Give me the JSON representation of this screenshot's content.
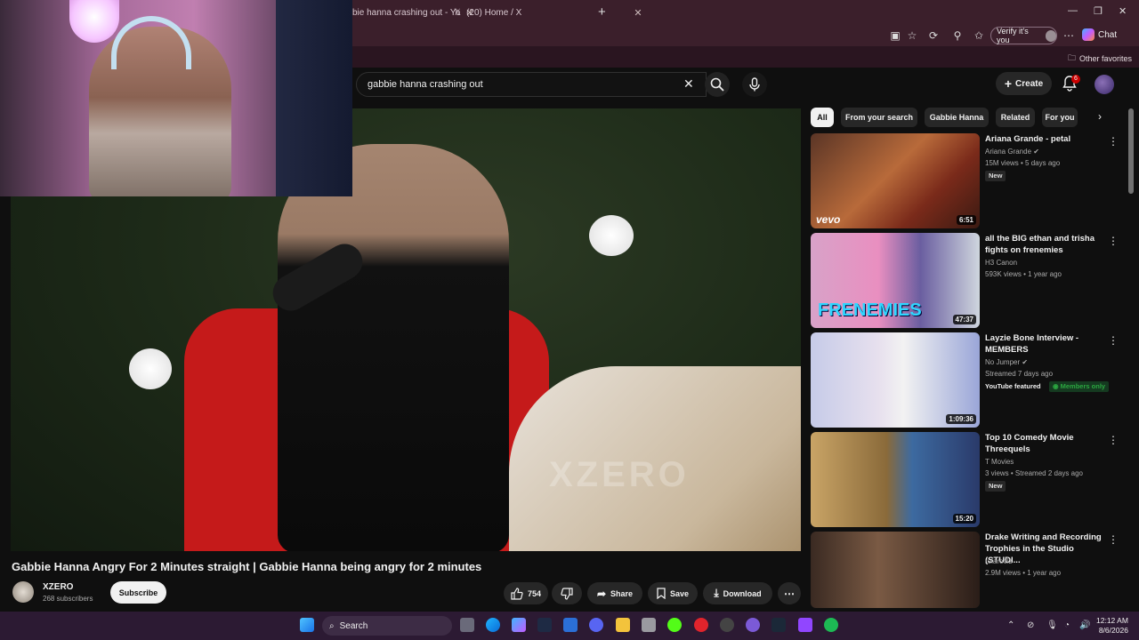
{
  "browser": {
    "tabs": [
      {
        "label": "bie hanna crashing out - Yo"
      },
      {
        "label": "(20) Home / X"
      }
    ],
    "verify_label": "Verify it's you",
    "chat_label": "Chat",
    "other_favorites": "Other favorites"
  },
  "youtube": {
    "search_value": "gabbie hanna crashing out",
    "create_label": "Create",
    "notification_count": "6"
  },
  "video": {
    "watermark": "XZERO",
    "title": "Gabbie Hanna Angry For 2 Minutes straight | Gabbie Hanna being angry for 2 minutes",
    "channel": "XZERO",
    "subscribers": "268 subscribers",
    "subscribe_label": "Subscribe",
    "likes": "754",
    "share_label": "Share",
    "save_label": "Save",
    "download_label": "Download"
  },
  "chips": [
    {
      "label": "All"
    },
    {
      "label": "From your search"
    },
    {
      "label": "Gabbie Hanna"
    },
    {
      "label": "Related"
    },
    {
      "label": "For you"
    }
  ],
  "recommendations": [
    {
      "title": "Ariana Grande - petal",
      "channel": "Ariana Grande",
      "meta": "15M views • 5 days ago",
      "badge": "New",
      "duration": "6:51",
      "overlay": "vevo"
    },
    {
      "title": "all the BIG ethan and trisha fights on frenemies",
      "channel": "H3 Canon",
      "meta": "593K views • 1 year ago",
      "badge": "",
      "duration": "47:37",
      "overlay": "FRENEMIES"
    },
    {
      "title": "Layzie Bone Interview - MEMBERS",
      "channel": "No Jumper",
      "meta": "Streamed 7 days ago",
      "badge": "YouTube featured",
      "badge2": "Members only",
      "duration": "1:09:36"
    },
    {
      "title": "Top 10 Comedy Movie Threequels",
      "channel": "T Movies",
      "meta": "3 views • Streamed 2 days ago",
      "badge": "New",
      "duration": "15:20"
    },
    {
      "title": "Drake Writing and Recording Trophies in the Studio (STUDI...",
      "channel": "rolaroolz",
      "meta": "2.9M views • 1 year ago",
      "badge": "",
      "duration": ""
    }
  ],
  "taskbar": {
    "search_label": "Search",
    "time": "12:12 AM",
    "date": "8/6/2026"
  }
}
